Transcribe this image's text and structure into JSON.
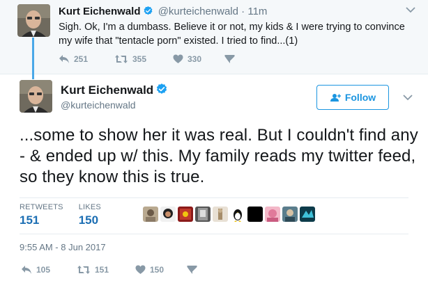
{
  "parent_tweet": {
    "name": "Kurt Eichenwald",
    "handle": "@kurteichenwald",
    "separator": "·",
    "time": "11m",
    "text": "Sigh. Ok, I'm a dumbass. Believe it or not, my kids & I were trying to convince my wife that \"tentacle porn\" existed. I tried to find...(1)",
    "replies": "251",
    "retweets": "355",
    "likes": "330"
  },
  "main_tweet": {
    "name": "Kurt Eichenwald",
    "handle": "@kurteichenwald",
    "follow_label": "Follow",
    "text": "...some to show her it was real. But I couldn't find any - & ended up w/ this. My family reads my twitter feed, so they know this is true.",
    "stats": {
      "retweets_label": "RETWEETS",
      "retweets_value": "151",
      "likes_label": "LIKES",
      "likes_value": "150"
    },
    "timestamp": "9:55 AM - 8 Jun 2017",
    "actions": {
      "replies": "105",
      "retweets": "151",
      "likes": "150"
    }
  },
  "colors": {
    "accent": "#1b95e0",
    "verified": "#1da1f2",
    "thread_line": "#4aa8e8",
    "muted": "#8899a6"
  },
  "icons": [
    "verified-badge-icon",
    "reply-icon",
    "retweet-icon",
    "like-icon",
    "direct-message-icon",
    "chevron-down-icon",
    "follow-person-icon"
  ]
}
